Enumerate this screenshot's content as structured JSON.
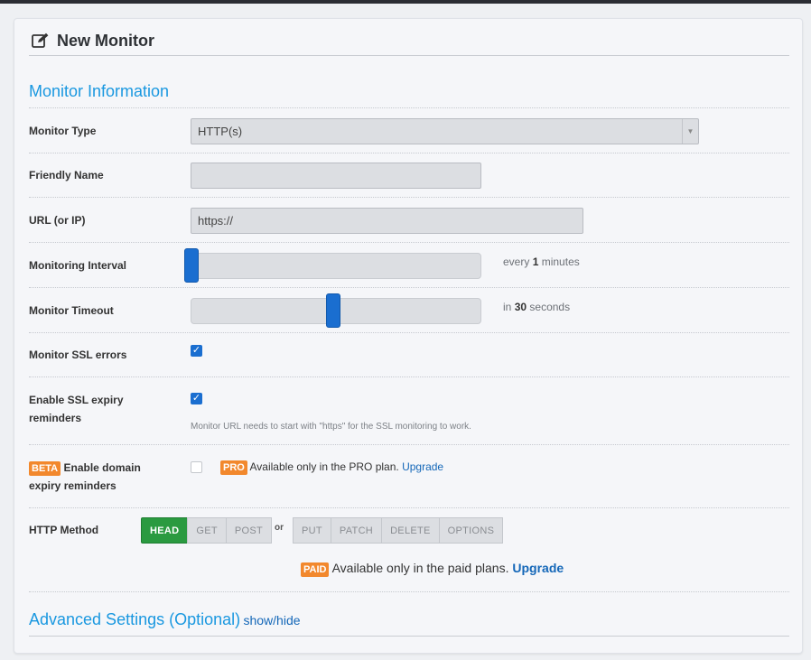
{
  "header": {
    "title": "New Monitor"
  },
  "sections": {
    "info": "Monitor Information",
    "advanced": "Advanced Settings (Optional)",
    "advanced_toggle": "show/hide"
  },
  "fields": {
    "monitor_type": {
      "label": "Monitor Type",
      "value": "HTTP(s)"
    },
    "friendly_name": {
      "label": "Friendly Name",
      "value": ""
    },
    "url": {
      "label": "URL (or IP)",
      "value": "https://"
    },
    "interval": {
      "label": "Monitoring Interval",
      "prefix": "every",
      "value": "1",
      "suffix": "minutes",
      "level": 0
    },
    "timeout": {
      "label": "Monitor Timeout",
      "prefix": "in",
      "value": "30",
      "suffix": "seconds",
      "level": 0.5
    },
    "ssl_errors": {
      "label": "Monitor SSL errors",
      "checked": true
    },
    "ssl_expiry": {
      "label_1": "Enable SSL expiry",
      "label_2": "reminders",
      "checked": true,
      "note": "Monitor URL needs to start with \"https\" for the SSL monitoring to work."
    },
    "domain_expiry": {
      "badge": "BETA",
      "label_1": "Enable domain",
      "label_2": "expiry reminders",
      "checked": false,
      "pro_badge": "PRO",
      "pro_text": "Available only in the PRO plan.",
      "upgrade": "Upgrade"
    },
    "http_method": {
      "label": "HTTP Method",
      "methods_a": [
        "HEAD",
        "GET",
        "POST"
      ],
      "or": "or",
      "methods_b": [
        "PUT",
        "PATCH",
        "DELETE",
        "OPTIONS"
      ],
      "selected": "HEAD",
      "paid_badge": "PAID",
      "paid_text": "Available only in the paid plans.",
      "upgrade": "Upgrade"
    }
  },
  "icons": {
    "header": "edit-icon",
    "select": "caret-down-icon",
    "check": "checkmark-icon"
  },
  "colors": {
    "accent": "#1a98e0",
    "primary": "#1a6ed0",
    "badge": "#f2882d",
    "active_method": "#2a9a40"
  }
}
